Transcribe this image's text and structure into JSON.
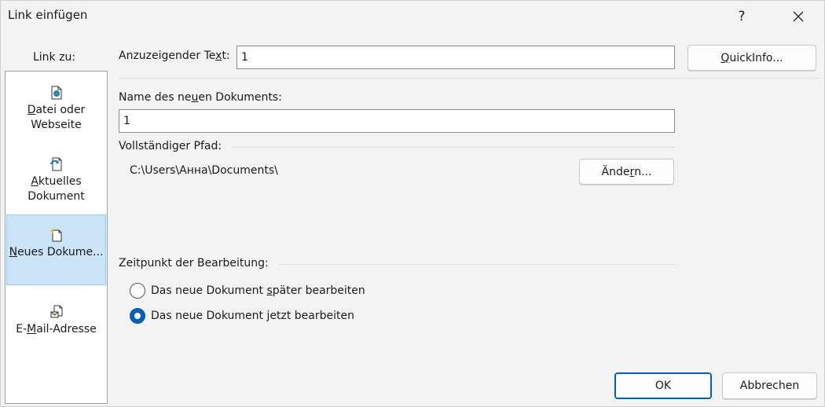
{
  "window": {
    "title": "Link einfügen",
    "help_label": "?",
    "close_icon": "close-icon"
  },
  "link_to": {
    "label": "Link zu:",
    "items": [
      {
        "pre": "",
        "key": "D",
        "post": "atei oder Webseite",
        "icon": "file-web-icon",
        "selected": false
      },
      {
        "pre": "",
        "key": "A",
        "post": "ktuelles Dokument",
        "icon": "current-document-icon",
        "selected": false
      },
      {
        "pre": "",
        "key": "N",
        "post": "eues Dokume...",
        "icon": "new-document-icon",
        "selected": true
      },
      {
        "pre": "E-",
        "key": "M",
        "post": "ail-Adresse",
        "icon": "email-icon",
        "selected": false
      }
    ]
  },
  "display_text": {
    "label_pre": "Anzuzeigender Te",
    "label_key": "x",
    "label_post": "t:",
    "value": "1"
  },
  "quickinfo": {
    "key": "Q",
    "post": "uickInfo..."
  },
  "new_doc_name": {
    "label_pre": "Name des ne",
    "label_key": "u",
    "label_post": "en Dokuments:",
    "value": "1"
  },
  "full_path": {
    "label": "Vollständiger Pfad:",
    "value": "C:\\Users\\Анна\\Documents\\",
    "change_pre": "Ände",
    "change_key": "r",
    "change_post": "n..."
  },
  "edit_time": {
    "label": "Zeitpunkt der Bearbeitung:",
    "options": [
      {
        "pre": "Das neue Dokument ",
        "key": "s",
        "post": "päter bearbeiten",
        "checked": false
      },
      {
        "pre": "Das neue Dokument ",
        "key": "j",
        "post": "etzt bearbeiten",
        "checked": true
      }
    ]
  },
  "buttons": {
    "ok": "OK",
    "cancel": "Abbrechen"
  },
  "colors": {
    "accent": "#005fb8",
    "selection": "#cce4f7"
  }
}
